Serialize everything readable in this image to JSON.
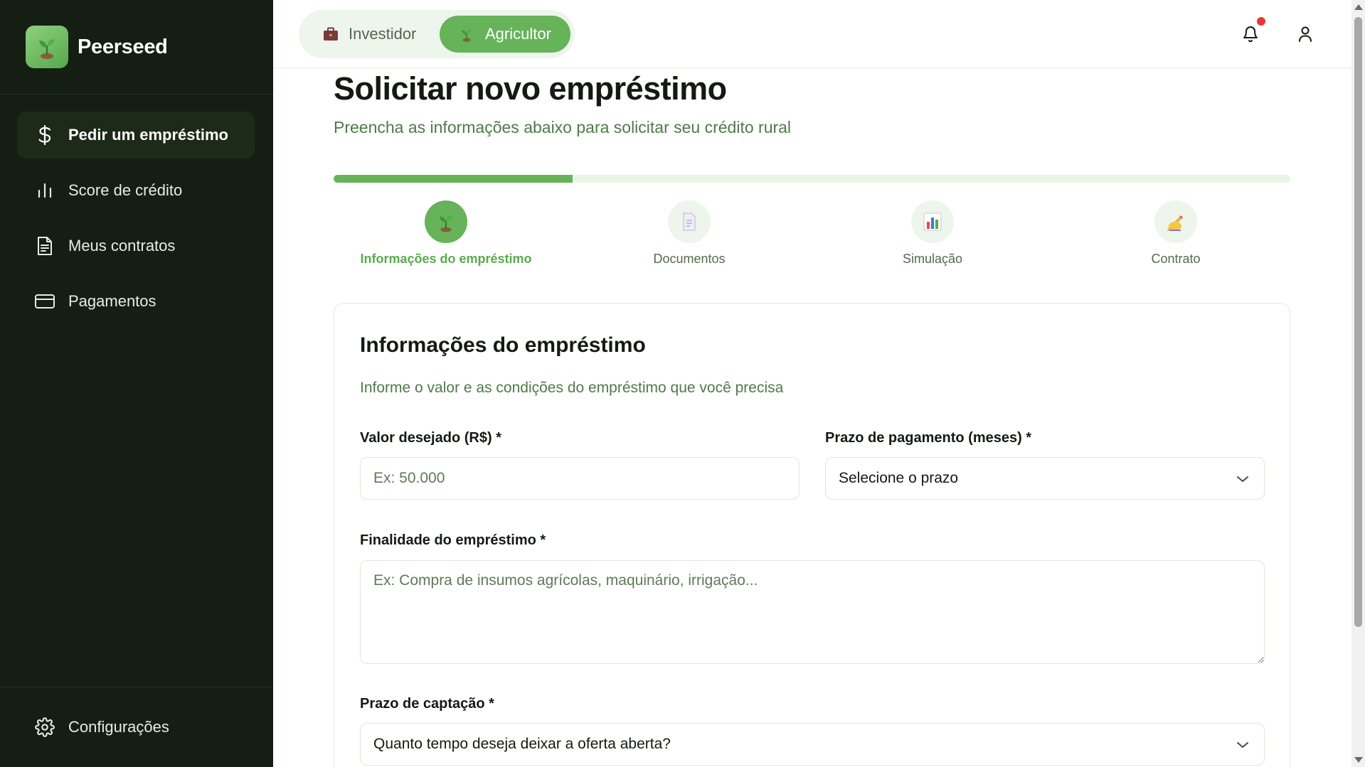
{
  "brand": {
    "name": "Peerseed"
  },
  "sidebar": {
    "items": [
      {
        "label": "Pedir um empréstimo",
        "icon": "dollar-icon",
        "active": true
      },
      {
        "label": "Score de crédito",
        "icon": "bar-chart-icon",
        "active": false
      },
      {
        "label": "Meus contratos",
        "icon": "document-icon",
        "active": false
      },
      {
        "label": "Pagamentos",
        "icon": "credit-card-icon",
        "active": false
      }
    ],
    "settings_label": "Configurações"
  },
  "header": {
    "role_investor": "Investidor",
    "role_farmer": "Agricultor",
    "active_role": "Agricultor",
    "has_notification": true
  },
  "page": {
    "title": "Solicitar novo empréstimo",
    "subtitle": "Preencha as informações abaixo para solicitar seu crédito rural"
  },
  "progress": {
    "percent": 25
  },
  "steps": [
    {
      "label": "Informações do empréstimo",
      "icon": "seedling-icon",
      "active": true
    },
    {
      "label": "Documentos",
      "icon": "page-icon",
      "active": false
    },
    {
      "label": "Simulação",
      "icon": "bar-chart-icon",
      "active": false
    },
    {
      "label": "Contrato",
      "icon": "writing-hand-icon",
      "active": false
    }
  ],
  "form": {
    "title": "Informações do empréstimo",
    "subtitle": "Informe o valor e as condições do empréstimo que você precisa",
    "amount": {
      "label": "Valor desejado (R$) *",
      "placeholder": "Ex: 50.000",
      "value": ""
    },
    "term": {
      "label": "Prazo de pagamento (meses) *",
      "selected": "Selecione o prazo"
    },
    "purpose": {
      "label": "Finalidade do empréstimo *",
      "placeholder": "Ex: Compra de insumos agrícolas, maquinário, irrigação...",
      "value": ""
    },
    "funding": {
      "label": "Prazo de captação *",
      "selected": "Quanto tempo deseja deixar a oferta aberta?"
    }
  },
  "colors": {
    "sidebar_bg": "#141e12",
    "accent": "#66b35a",
    "muted_text": "#4f7a49",
    "notification": "#e53935"
  }
}
